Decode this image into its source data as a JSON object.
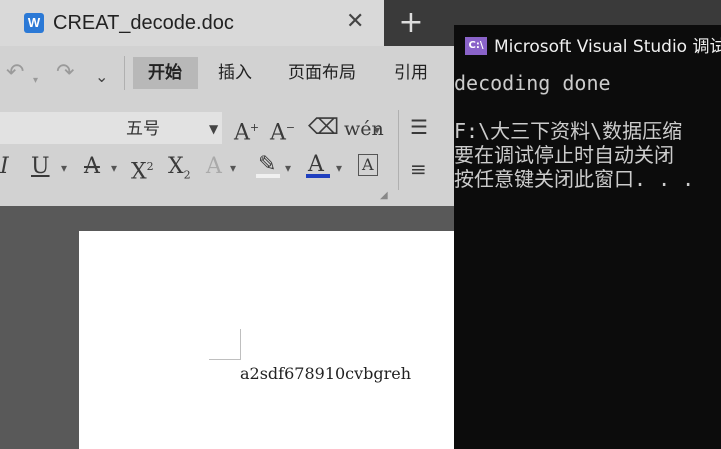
{
  "word": {
    "tab_title": "CREAT_decode.doc",
    "tab_icon_letter": "W",
    "close_glyph": "✕",
    "new_tab_glyph": "+",
    "menu": [
      "开始",
      "插入",
      "页面布局",
      "引用"
    ],
    "font_size": "五号",
    "document_text": "a2sdf678910cvbgreh"
  },
  "console": {
    "icon_text": "C:\\",
    "title": "Microsoft Visual Studio 调试控制台",
    "lines": [
      "decoding done",
      "",
      "F:\\大三下资料\\数据压缩",
      "要在调试停止时自动关闭",
      "按任意键关闭此窗口. . ."
    ]
  },
  "colors": {
    "word_accent": "#2b79d6",
    "console_bg": "#0c0c0c",
    "font_color_bar": "#1f3fbf",
    "highlight_bar": "#f0f0f0"
  }
}
